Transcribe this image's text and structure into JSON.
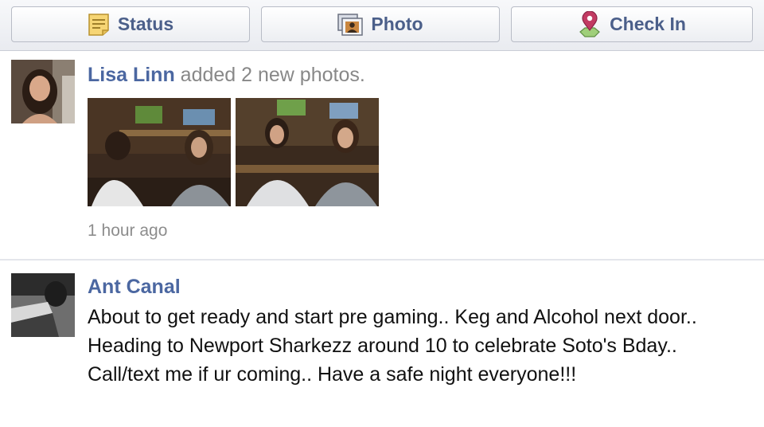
{
  "toolbar": {
    "status_label": "Status",
    "photo_label": "Photo",
    "checkin_label": "Check In",
    "icons": {
      "status": "note-icon",
      "photo": "photo-icon",
      "checkin": "map-pin-icon"
    }
  },
  "feed": {
    "stories": [
      {
        "author": "Lisa Linn",
        "action": " added 2 new photos.",
        "timestamp": "1 hour ago"
      },
      {
        "author": "Ant Canal",
        "text": "About to get ready and start pre gaming.. Keg and Alcohol next door.. Heading to Newport Sharkezz around 10 to celebrate Soto's Bday.. Call/text me if ur coming.. Have a safe night everyone!!!"
      }
    ]
  },
  "colors": {
    "link": "#4b67a1",
    "meta_text": "#888888",
    "button_text": "#4b5f8a"
  }
}
